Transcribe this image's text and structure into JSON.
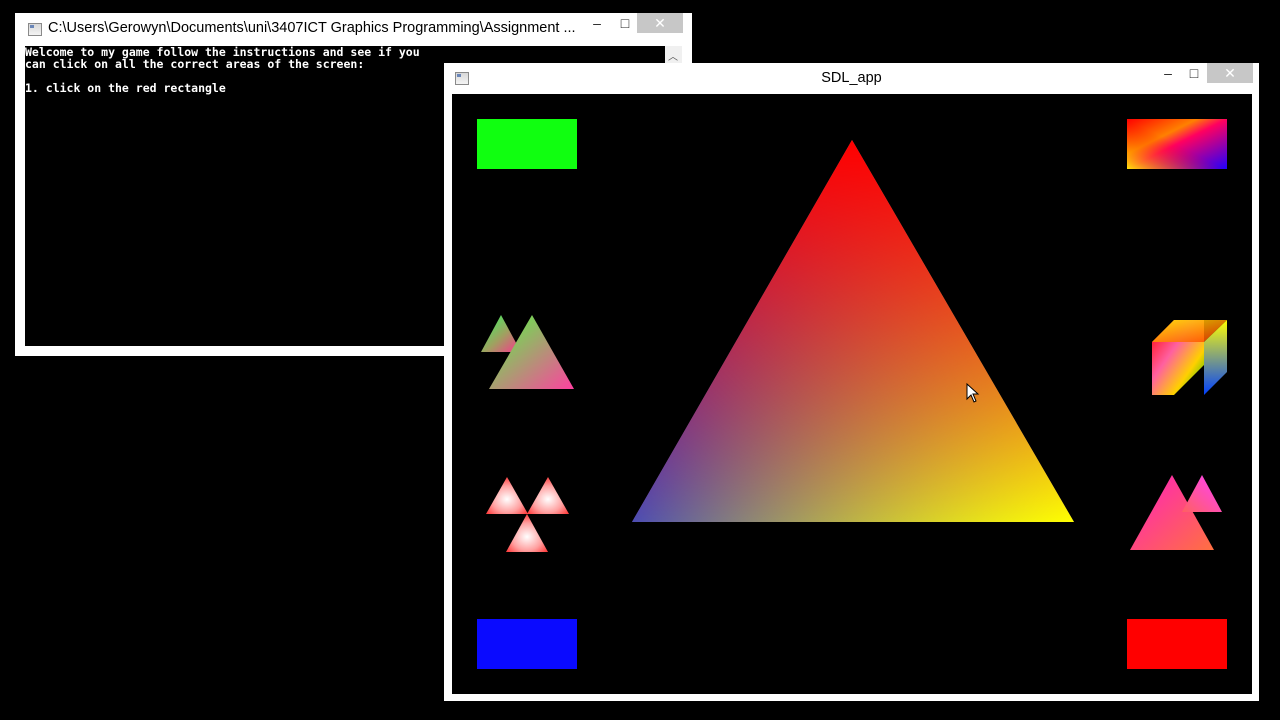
{
  "console_window": {
    "title": "C:\\Users\\Gerowyn\\Documents\\uni\\3407ICT Graphics Programming\\Assignment ...",
    "minimize_glyph": "–",
    "maximize_glyph": "□",
    "close_glyph": "✕",
    "lines": [
      "Welcome to my game follow the instructions and see if you",
      "can click on all the correct areas of the screen:",
      "",
      "1. click on the red rectangle"
    ]
  },
  "sdl_window": {
    "title": "SDL_app",
    "minimize_glyph": "–",
    "maximize_glyph": "□",
    "close_glyph": "✕",
    "shapes": {
      "green_rectangle": "#10ff10",
      "blue_rectangle": "#0a0aff",
      "red_rectangle": "#ff0000",
      "gradient_rectangle": [
        "#ff0000",
        "#ffff00",
        "#0000ff"
      ],
      "big_triangle_vertices": [
        "#ff0000",
        "#0000ff",
        "#ffff00"
      ]
    }
  },
  "cursor": "arrow-cursor-icon"
}
